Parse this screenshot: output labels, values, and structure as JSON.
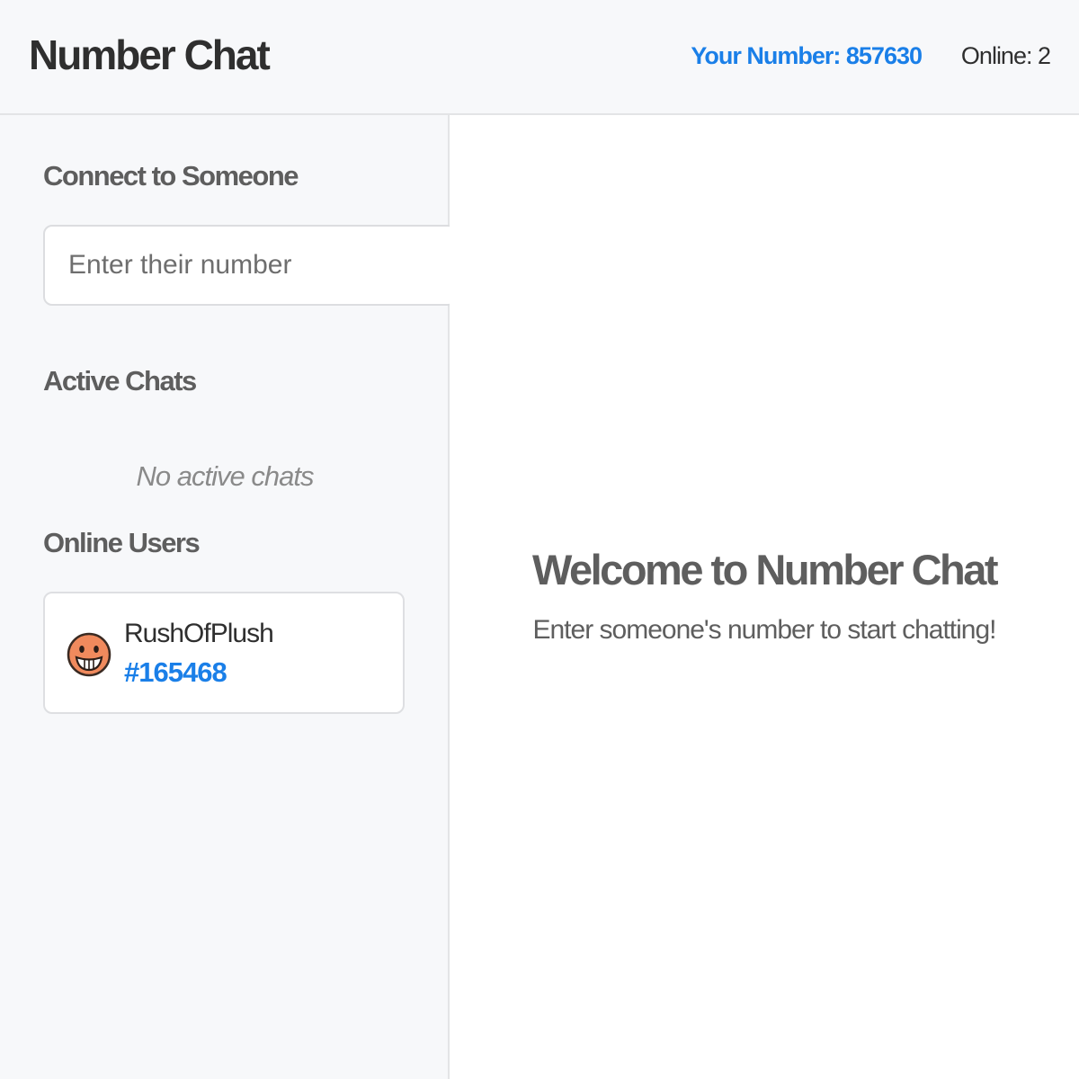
{
  "header": {
    "title": "Number Chat",
    "your_number": "Your Number: 857630",
    "online": "Online: 2"
  },
  "sidebar": {
    "connect_title": "Connect to Someone",
    "number_input": {
      "placeholder": "Enter their number",
      "value": ""
    },
    "active_chats_title": "Active Chats",
    "active_chats_empty": "No active chats",
    "online_users_title": "Online Users",
    "online_users": [
      {
        "name": "RushOfPlush",
        "number": "#165468",
        "avatar_icon": "smiley-face-avatar-icon"
      }
    ]
  },
  "main": {
    "welcome_title": "Welcome to Number Chat",
    "welcome_subtitle": "Enter someone's number to start chatting!"
  },
  "colors": {
    "accent": "#1a7fe8",
    "avatar_face": "#f08a5d",
    "heading_gray": "#5e5e5e",
    "panel_bg": "#f7f8fa"
  }
}
